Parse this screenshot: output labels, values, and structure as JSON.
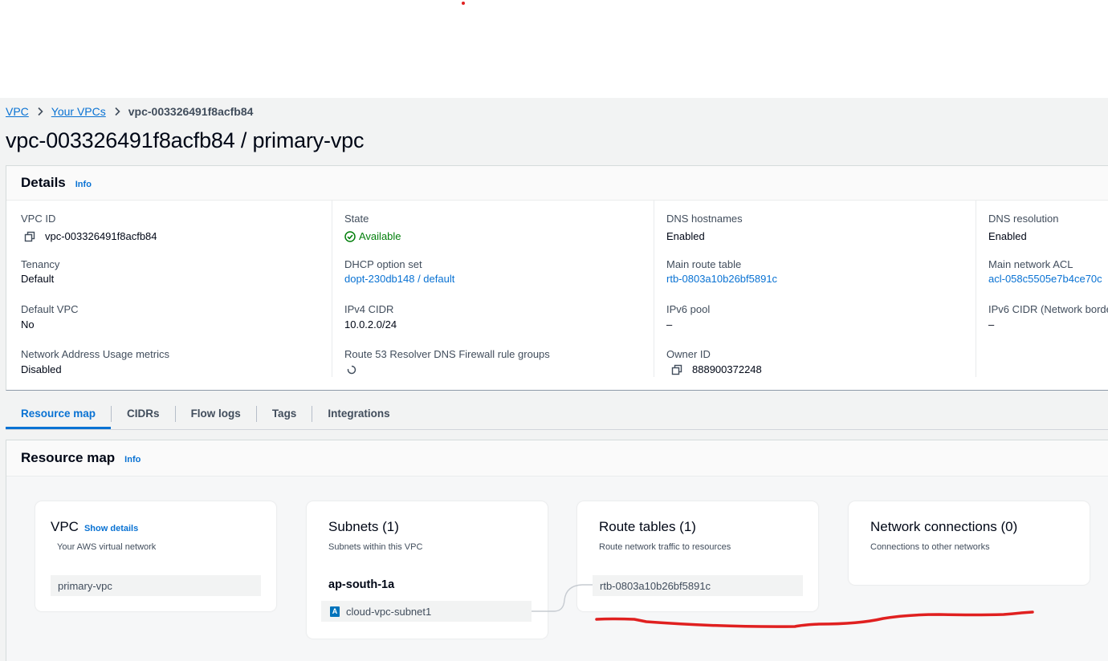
{
  "breadcrumb": {
    "items": [
      "VPC",
      "Your VPCs"
    ],
    "current": "vpc-003326491f8acfb84"
  },
  "page_title": "vpc-003326491f8acfb84 / primary-vpc",
  "details": {
    "title": "Details",
    "info": "Info",
    "columns": [
      [
        {
          "label": "VPC ID",
          "value": "vpc-003326491f8acfb84",
          "copy": true
        },
        {
          "label": "Tenancy",
          "value": "Default"
        },
        {
          "label": "Default VPC",
          "value": "No"
        },
        {
          "label": "Network Address Usage metrics",
          "value": "Disabled"
        }
      ],
      [
        {
          "label": "State",
          "value": "Available",
          "status": "success"
        },
        {
          "label": "DHCP option set",
          "value": "dopt-230db148 / default",
          "link": true
        },
        {
          "label": "IPv4 CIDR",
          "value": "10.0.2.0/24"
        },
        {
          "label": "Route 53 Resolver DNS Firewall rule groups",
          "value": "",
          "loading": true
        }
      ],
      [
        {
          "label": "DNS hostnames",
          "value": "Enabled"
        },
        {
          "label": "Main route table",
          "value": "rtb-0803a10b26bf5891c",
          "link": true
        },
        {
          "label": "IPv6 pool",
          "value": "–"
        },
        {
          "label": "Owner ID",
          "value": "888900372248",
          "copy": true
        }
      ],
      [
        {
          "label": "DNS resolution",
          "value": "Enabled"
        },
        {
          "label": "Main network ACL",
          "value": "acl-058c5505e7b4ce70c",
          "link": true
        },
        {
          "label": "IPv6 CIDR (Network borde",
          "value": "–"
        }
      ]
    ]
  },
  "tabs": [
    {
      "label": "Resource map",
      "active": true
    },
    {
      "label": "CIDRs"
    },
    {
      "label": "Flow logs"
    },
    {
      "label": "Tags"
    },
    {
      "label": "Integrations"
    }
  ],
  "resource_map": {
    "title": "Resource map",
    "info": "Info",
    "vpc_card": {
      "title": "VPC",
      "show_details": "Show details",
      "subtitle": "Your AWS virtual network",
      "item": "primary-vpc"
    },
    "subnets_card": {
      "title": "Subnets (1)",
      "subtitle": "Subnets within this VPC",
      "az": "ap-south-1a",
      "badge": "A",
      "item": "cloud-vpc-subnet1"
    },
    "route_tables_card": {
      "title": "Route tables (1)",
      "subtitle": "Route network traffic to resources",
      "item": "rtb-0803a10b26bf5891c"
    },
    "network_card": {
      "title": "Network connections (0)",
      "subtitle": "Connections to other networks"
    }
  },
  "colors": {
    "link": "#0972d3",
    "success": "#037f0c",
    "annotation": "#e02020",
    "badge": "#0073bb"
  }
}
